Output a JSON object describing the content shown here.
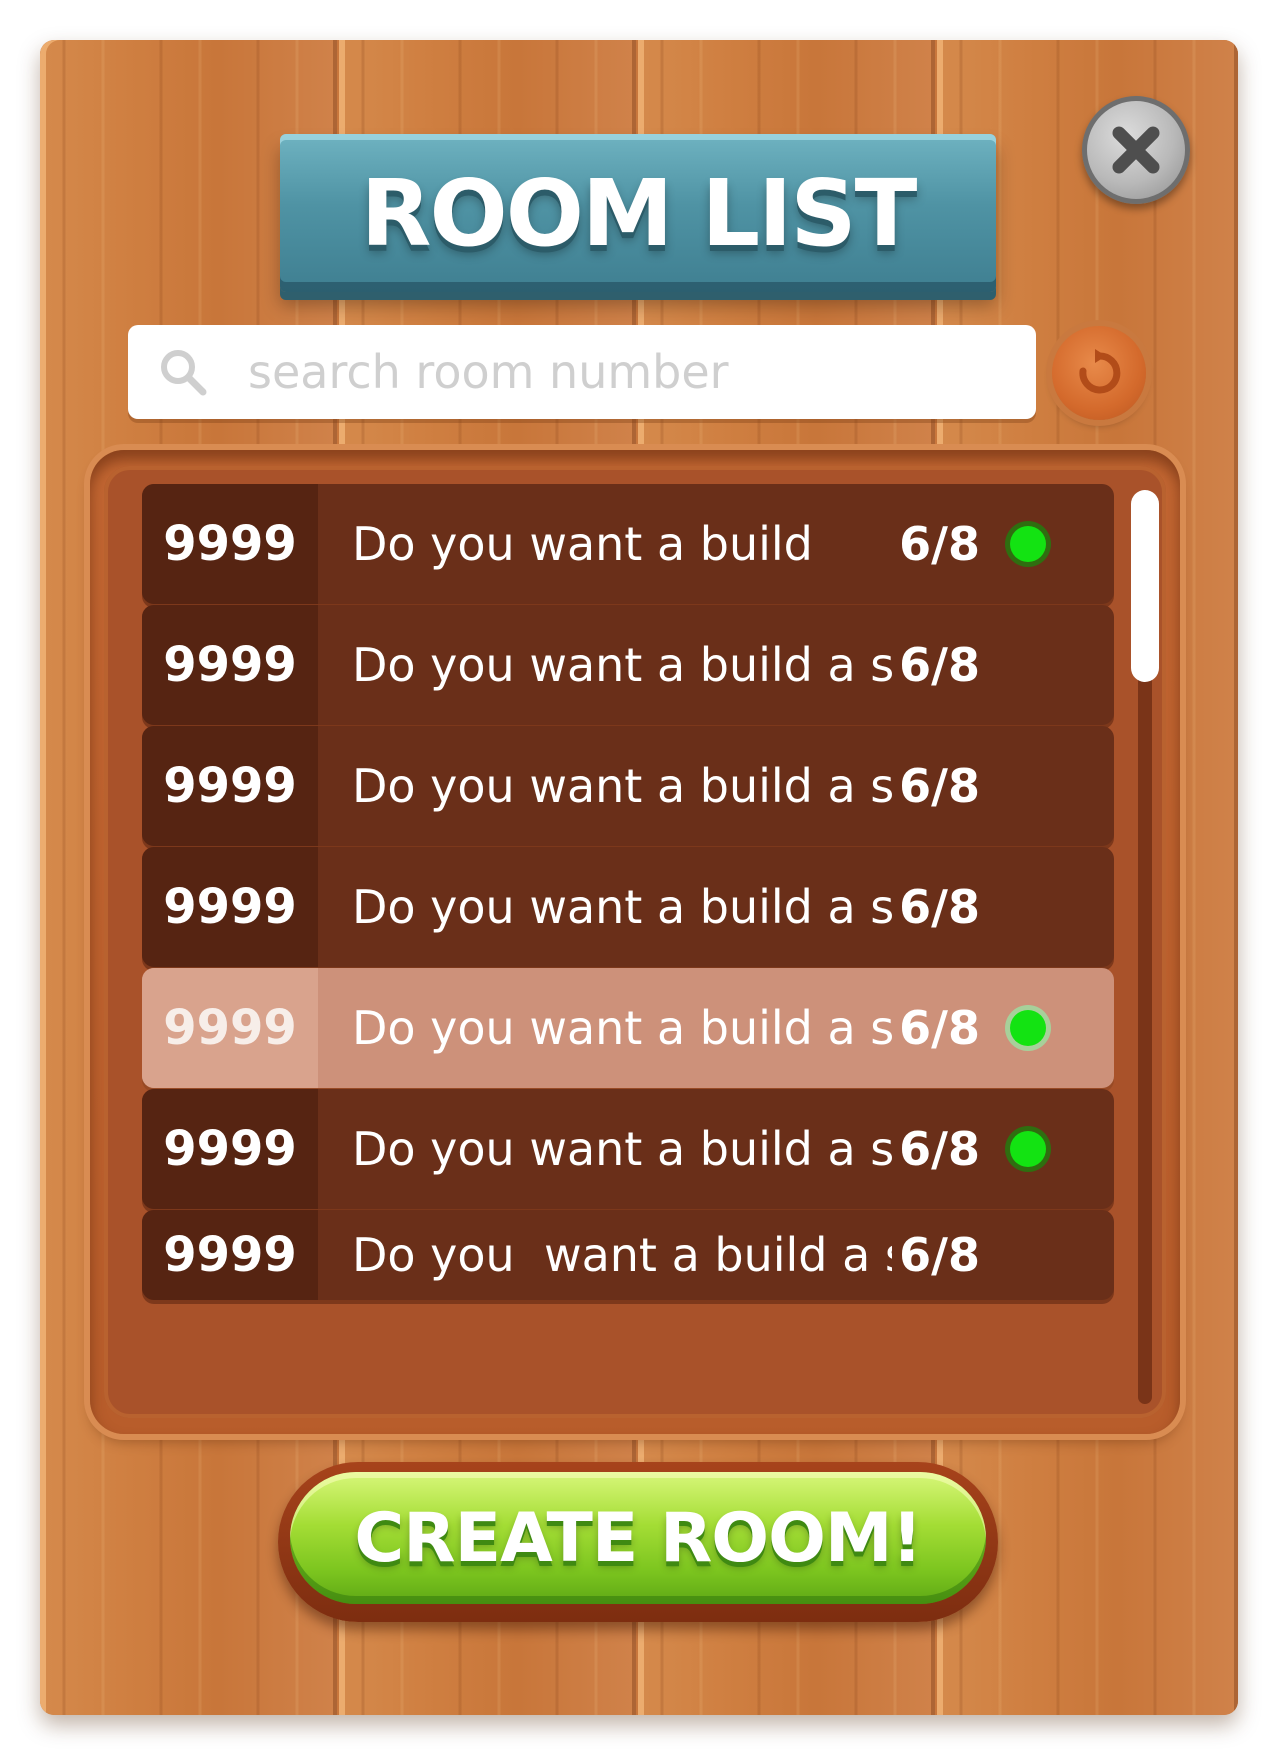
{
  "header": {
    "title": "ROOM LIST"
  },
  "search": {
    "placeholder": "search room number",
    "value": ""
  },
  "rooms": [
    {
      "number": "9999",
      "title": "Do you want a build",
      "count": "6/8",
      "online": true,
      "selected": false
    },
    {
      "number": "9999",
      "title": "Do you want a build a s",
      "count": "6/8",
      "online": false,
      "selected": false
    },
    {
      "number": "9999",
      "title": "Do you want a build a s",
      "count": "6/8",
      "online": false,
      "selected": false
    },
    {
      "number": "9999",
      "title": "Do you want a build a s",
      "count": "6/8",
      "online": false,
      "selected": false
    },
    {
      "number": "9999",
      "title": "Do you want a build a s",
      "count": "6/8",
      "online": true,
      "selected": true
    },
    {
      "number": "9999",
      "title": "Do you want a build a s",
      "count": "6/8",
      "online": true,
      "selected": false
    },
    {
      "number": "9999",
      "title": "Do you  want a build a s",
      "count": "6/8",
      "online": false,
      "selected": false
    }
  ],
  "footer": {
    "create_label": "CREATE ROOM!"
  },
  "colors": {
    "wood": "#c9773c",
    "banner": "#4f93a4",
    "row": "#6a2f19",
    "row_selected": "#cd917a",
    "status_online": "#13e312",
    "create_button": "#7cc51f"
  },
  "icons": {
    "close": "close-icon",
    "search": "search-icon",
    "refresh": "refresh-icon"
  }
}
